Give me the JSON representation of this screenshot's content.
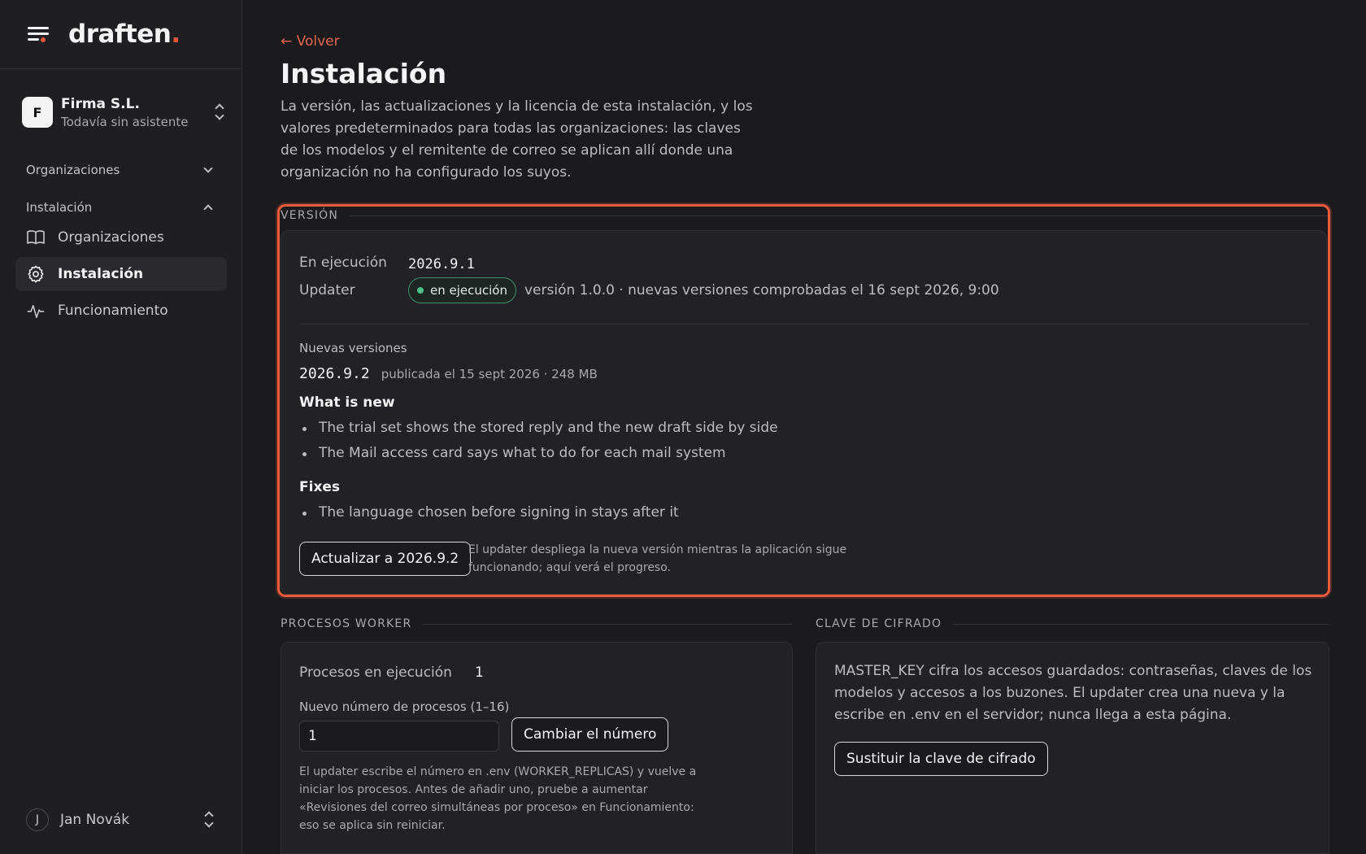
{
  "brand": {
    "logo_text": "draften",
    "logo_dot": "."
  },
  "org": {
    "avatar": "F",
    "name": "Firma S.L.",
    "subtitle": "Todavía sin asistente"
  },
  "nav": {
    "group_orgs": "Organizaciones",
    "group_install": "Instalación",
    "items": [
      {
        "label": "Organizaciones",
        "icon": "book-open-icon"
      },
      {
        "label": "Instalación",
        "icon": "gear-icon"
      },
      {
        "label": "Funcionamiento",
        "icon": "activity-icon"
      }
    ]
  },
  "user": {
    "avatar": "J",
    "name": "Jan Novák"
  },
  "page": {
    "back": "← Volver",
    "title": "Instalación",
    "description": "La versión, las actualizaciones y la licencia de esta instalación, y los valores predeterminados para todas las organizaciones: las claves de los modelos y el remitente de correo se aplican allí donde una organización no ha configurado los suyos."
  },
  "version": {
    "section_label": "VERSIÓN",
    "running_key": "En ejecución",
    "running_value": "2026.9.1",
    "updater_key": "Updater",
    "updater_status": "en ejecución",
    "updater_info": "versión 1.0.0 · nuevas versiones comprobadas el 16 sept 2026, 9:00",
    "new_versions_label": "Nuevas versiones",
    "new_version": "2026.9.2",
    "new_version_meta": "publicada el 15 sept 2026 · 248 MB",
    "whats_new_title": "What is new",
    "whats_new": [
      "The trial set shows the stored reply and the new draft side by side",
      "The Mail access card says what to do for each mail system"
    ],
    "fixes_title": "Fixes",
    "fixes": [
      "The language chosen before signing in stays after it"
    ],
    "update_button": "Actualizar a 2026.9.2",
    "update_note": "El updater despliega la nueva versión mientras la aplicación sigue funcionando; aquí verá el progreso."
  },
  "workers": {
    "section_label": "PROCESOS WORKER",
    "running_key": "Procesos en ejecución",
    "running_value": "1",
    "new_label": "Nuevo número de procesos (1–16)",
    "input_value": "1",
    "change_button": "Cambiar el número",
    "note": "El updater escribe el número en .env (WORKER_REPLICAS) y vuelve a iniciar los procesos. Antes de añadir uno, pruebe a aumentar «Revisiones del correo simultáneas por proceso» en Funcionamiento: eso se aplica sin reiniciar."
  },
  "encryption": {
    "section_label": "CLAVE DE CIFRADO",
    "text": "MASTER_KEY cifra los accesos guardados: contraseñas, claves de los modelos y accesos a los buzones. El updater crea una nueva y la escribe en .env en el servidor; nunca llega a esta página.",
    "button": "Sustituir la clave de cifrado"
  },
  "colors": {
    "accent": "#e2543b",
    "status_ok": "#4bbf85",
    "background": "#1b1b1e"
  }
}
